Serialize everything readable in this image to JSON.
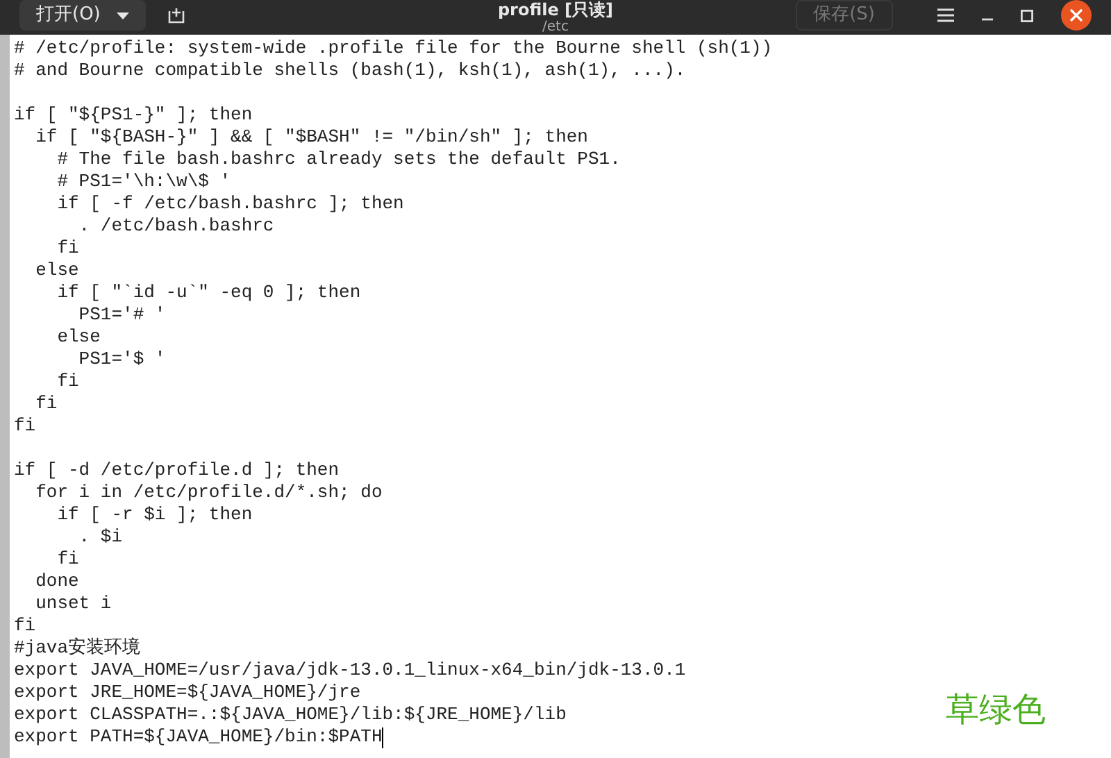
{
  "header": {
    "open_button": "打开(O)",
    "title": "profile [只读]",
    "subtitle": "/etc",
    "save_button": "保存(S)"
  },
  "blocks": [
    [
      "# /etc/profile: system-wide .profile file for the Bourne shell (sh(1))",
      "# and Bourne compatible shells (bash(1), ksh(1), ash(1), ...)."
    ],
    [
      "if [ \"${PS1-}\" ]; then",
      "  if [ \"${BASH-}\" ] && [ \"$BASH\" != \"/bin/sh\" ]; then",
      "    # The file bash.bashrc already sets the default PS1.",
      "    # PS1='\\h:\\w\\$ '",
      "    if [ -f /etc/bash.bashrc ]; then",
      "      . /etc/bash.bashrc",
      "    fi",
      "  else",
      "    if [ \"`id -u`\" -eq 0 ]; then",
      "      PS1='# '",
      "    else",
      "      PS1='$ '",
      "    fi",
      "  fi",
      "fi"
    ],
    [
      "if [ -d /etc/profile.d ]; then",
      "  for i in /etc/profile.d/*.sh; do",
      "    if [ -r $i ]; then",
      "      . $i",
      "    fi",
      "  done",
      "  unset i",
      "fi",
      "#java安装环境",
      "export JAVA_HOME=/usr/java/jdk-13.0.1_linux-x64_bin/jdk-13.0.1",
      "export JRE_HOME=${JAVA_HOME}/jre",
      "export CLASSPATH=.:${JAVA_HOME}/lib:${JRE_HOME}/lib",
      "export PATH=${JAVA_HOME}/bin:$PATH"
    ]
  ],
  "annotation": {
    "text": "草绿色",
    "color": "#4caf20"
  }
}
